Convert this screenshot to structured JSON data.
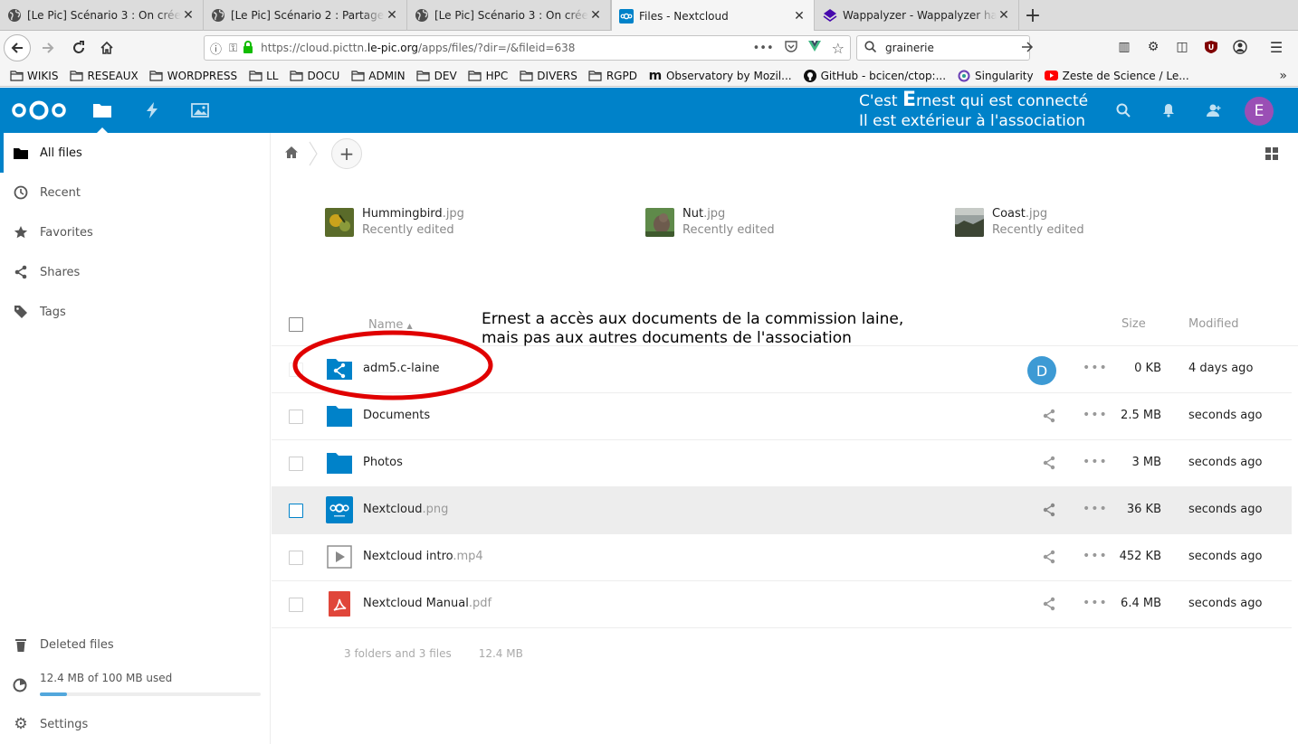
{
  "browser": {
    "tabs": [
      {
        "title": "[Le Pic] Scénario 3 : On crée un",
        "icon": "globe-icon"
      },
      {
        "title": "[Le Pic] Scénario 2 : Partage de",
        "icon": "globe-icon"
      },
      {
        "title": "[Le Pic] Scénario 3 : On crée un",
        "icon": "globe-icon"
      },
      {
        "title": "Files - Nextcloud",
        "icon": "nextcloud-icon"
      },
      {
        "title": "Wappalyzer - Wappalyzer has",
        "icon": "wappalyzer-icon"
      }
    ],
    "url_prefix": "https://cloud.picttn.",
    "url_domain": "le-pic.org",
    "url_suffix": "/apps/files/?dir=/&fileid=638",
    "search_value": "grainerie",
    "bookmarks": [
      {
        "label": "WIKIS",
        "icon": "folder-icon"
      },
      {
        "label": "RESEAUX",
        "icon": "folder-icon"
      },
      {
        "label": "WORDPRESS",
        "icon": "folder-icon"
      },
      {
        "label": "LL",
        "icon": "folder-icon"
      },
      {
        "label": "DOCU",
        "icon": "folder-icon"
      },
      {
        "label": "ADMIN",
        "icon": "folder-icon"
      },
      {
        "label": "DEV",
        "icon": "folder-icon"
      },
      {
        "label": "HPC",
        "icon": "folder-icon"
      },
      {
        "label": "DIVERS",
        "icon": "folder-icon"
      },
      {
        "label": "RGPD",
        "icon": "folder-icon"
      },
      {
        "label": "Observatory by Mozil...",
        "icon": "mozilla-icon"
      },
      {
        "label": "GitHub - bcicen/ctop:...",
        "icon": "github-icon"
      },
      {
        "label": "Singularity",
        "icon": "singularity-icon"
      },
      {
        "label": "Zeste de Science / Le...",
        "icon": "youtube-icon"
      }
    ]
  },
  "header": {
    "overlay_line1_pre": "C'est ",
    "overlay_line1_big": "E",
    "overlay_line1_post": "rnest qui est connecté",
    "overlay_line2": "Il est extérieur à l'association",
    "avatar_letter": "E",
    "brand_color": "#0082c9"
  },
  "sidebar": {
    "items": [
      {
        "label": "All files",
        "icon": "folder-icon"
      },
      {
        "label": "Recent",
        "icon": "clock-icon"
      },
      {
        "label": "Favorites",
        "icon": "star-icon"
      },
      {
        "label": "Shares",
        "icon": "share-icon"
      },
      {
        "label": "Tags",
        "icon": "tag-icon"
      }
    ],
    "deleted_label": "Deleted files",
    "quota_text": "12.4 MB of 100 MB used",
    "quota_fraction": 0.124,
    "settings_label": "Settings"
  },
  "recent": [
    {
      "name": "Hummingbird",
      "ext": ".jpg",
      "sub": "Recently edited"
    },
    {
      "name": "Nut",
      "ext": ".jpg",
      "sub": "Recently edited"
    },
    {
      "name": "Coast",
      "ext": ".jpg",
      "sub": "Recently edited"
    }
  ],
  "table": {
    "col_name": "Name",
    "col_size": "Size",
    "col_modified": "Modified",
    "rows": [
      {
        "name": "adm5.c-laine",
        "ext": "",
        "size": "0 KB",
        "modified": "4 days ago",
        "icon": "shared-folder-icon",
        "shared_with": "D"
      },
      {
        "name": "Documents",
        "ext": "",
        "size": "2.5 MB",
        "modified": "seconds ago",
        "icon": "folder-icon"
      },
      {
        "name": "Photos",
        "ext": "",
        "size": "3 MB",
        "modified": "seconds ago",
        "icon": "folder-icon"
      },
      {
        "name": "Nextcloud",
        "ext": ".png",
        "size": "36 KB",
        "modified": "seconds ago",
        "icon": "image-file-icon"
      },
      {
        "name": "Nextcloud intro",
        "ext": ".mp4",
        "size": "452 KB",
        "modified": "seconds ago",
        "icon": "video-file-icon"
      },
      {
        "name": "Nextcloud Manual",
        "ext": ".pdf",
        "size": "6.4 MB",
        "modified": "seconds ago",
        "icon": "pdf-file-icon"
      }
    ],
    "summary_counts": "3 folders and 3 files",
    "summary_size": "12.4 MB"
  },
  "annotation": {
    "line1": "Ernest a accès aux documents de la commission laine,",
    "line2": "mais pas aux autres documents de l'association",
    "circle_color": "#e00000"
  }
}
